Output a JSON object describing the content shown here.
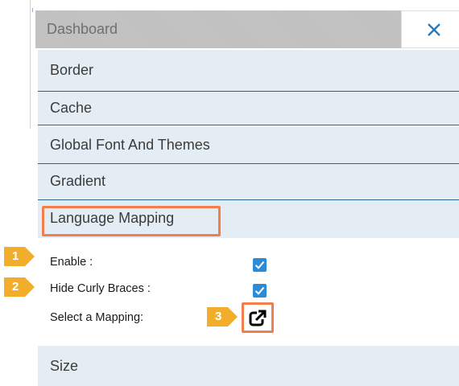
{
  "header": {
    "title": "Dashboard",
    "close_icon": "close-x-icon"
  },
  "sections": [
    {
      "label": "Border"
    },
    {
      "label": "Cache"
    },
    {
      "label": "Global Font And Themes"
    },
    {
      "label": "Gradient"
    },
    {
      "label": "Language Mapping",
      "expanded": true
    },
    {
      "label": "Size"
    }
  ],
  "language_mapping": {
    "enable_label": "Enable :",
    "enable_checked": true,
    "hide_curly_label": "Hide Curly Braces :",
    "hide_curly_checked": true,
    "select_mapping_label": "Select a Mapping:",
    "select_mapping_icon": "external-link-icon"
  },
  "markers": [
    {
      "number": "1"
    },
    {
      "number": "2"
    },
    {
      "number": "3"
    }
  ],
  "colors": {
    "section_bg": "#e3edf3",
    "section_border": "#2a6496",
    "highlight": "#f07f4d",
    "marker": "#f2ae2b",
    "checkbox": "#2d8ad6",
    "close_x": "#2a7ab8"
  }
}
